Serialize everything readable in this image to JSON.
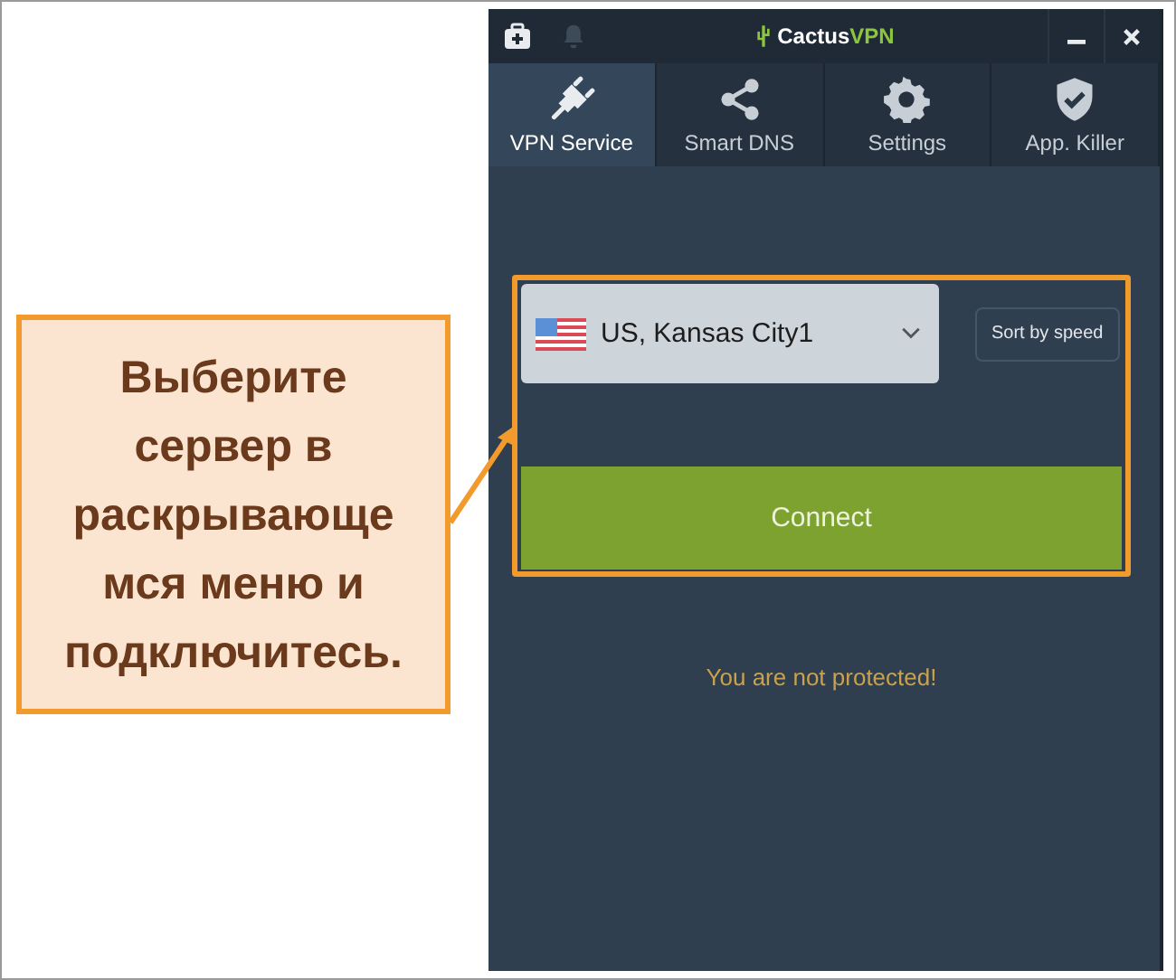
{
  "titlebar": {
    "logo": {
      "word": "Cactus",
      "accent": "VPN"
    }
  },
  "tabs": [
    {
      "label": "VPN Service",
      "kind": "plug",
      "selected": true
    },
    {
      "label": "Smart DNS",
      "kind": "share",
      "selected": false
    },
    {
      "label": "Settings",
      "kind": "gear",
      "selected": false
    },
    {
      "label": "App. Killer",
      "kind": "shield",
      "selected": false
    }
  ],
  "server_select": {
    "value": "US, Kansas City1"
  },
  "sort_button": "Sort by speed",
  "connect_button": "Connect",
  "status": "You are not protected!",
  "callout": {
    "lines": [
      "Выберите",
      "сервер в",
      "раскрывающе",
      "мся меню и",
      "подключитесь."
    ]
  }
}
